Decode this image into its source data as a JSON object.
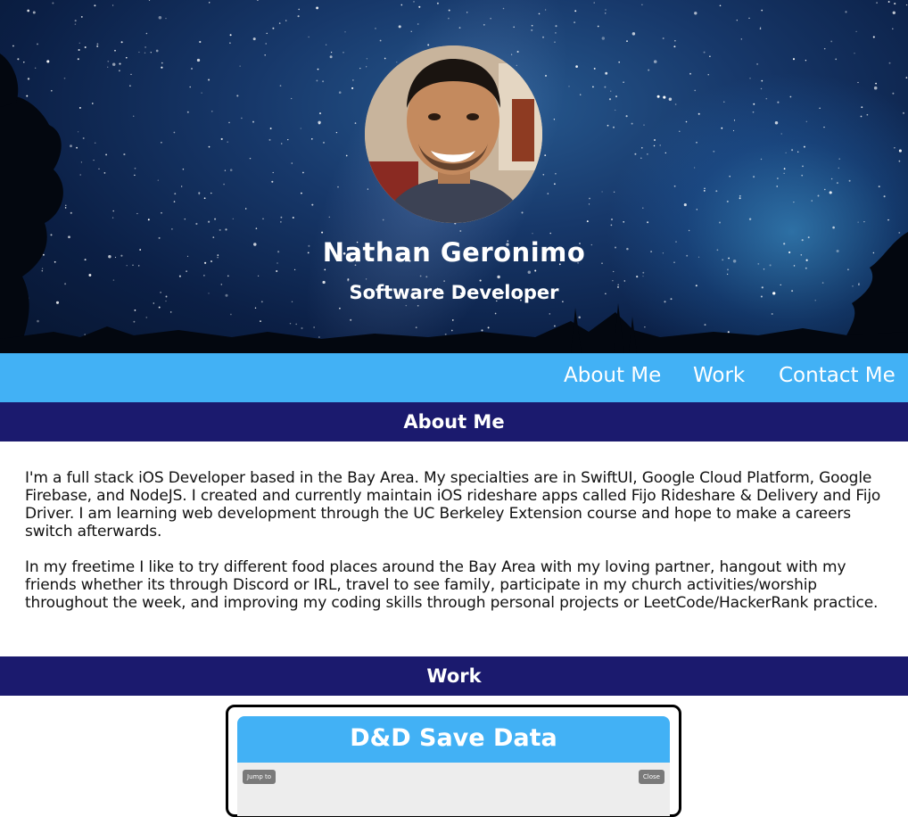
{
  "hero": {
    "name": "Nathan Geronimo",
    "role": "Software Developer"
  },
  "nav": {
    "items": [
      {
        "label": "About Me"
      },
      {
        "label": "Work"
      },
      {
        "label": "Contact Me"
      }
    ]
  },
  "about": {
    "heading": "About Me",
    "paragraphs": [
      "I'm a full stack iOS Developer based in the Bay Area. My specialties are in SwiftUI, Google Cloud Platform, Google Firebase, and NodeJS. I created and currently maintain iOS rideshare apps called Fijo Rideshare & Delivery and Fijo Driver. I am learning web development through the UC Berkeley Extension course and hope to make a careers switch afterwards.",
      "In my freetime I like to try different food places around the Bay Area with my loving partner, hangout with my friends whether its through Discord or IRL, travel to see family, participate in my church activities/worship throughout the week, and improving my coding skills through personal projects or LeetCode/HackerRank practice."
    ]
  },
  "work": {
    "heading": "Work",
    "projects": [
      {
        "title": "D&D Save Data",
        "preview_left_button": "Jump to",
        "preview_right_button": "Close"
      }
    ]
  },
  "colors": {
    "nav_bg": "#42b1f5",
    "section_bg": "#1b1a6e",
    "text": "#111111"
  }
}
